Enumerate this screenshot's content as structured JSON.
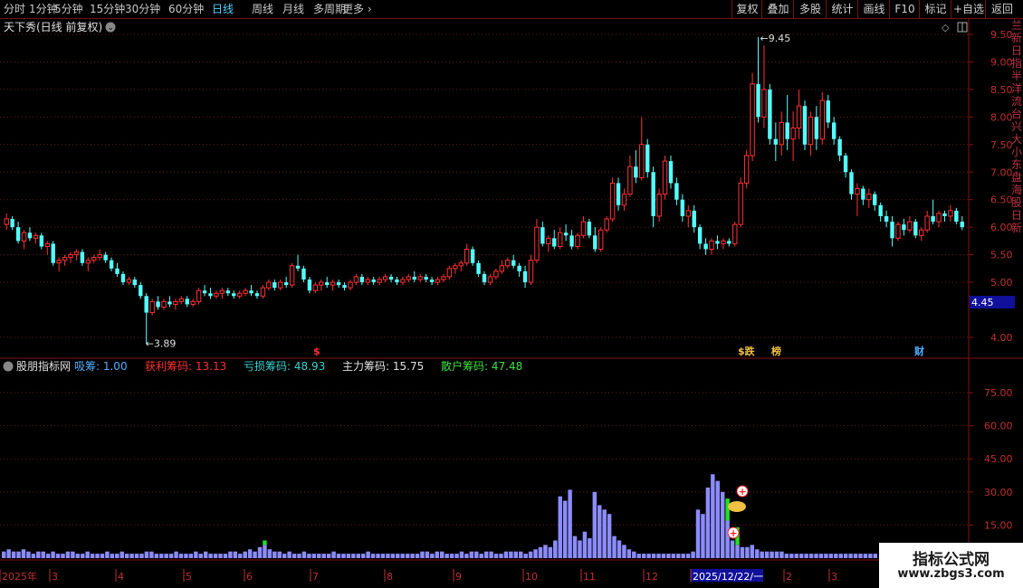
{
  "toolbar": {
    "periods": [
      "分时",
      "1分钟",
      "5分钟",
      "15分钟",
      "30分钟",
      "60分钟",
      "日线",
      "周线",
      "月线",
      "多周期",
      "更多"
    ],
    "active_period": "日线",
    "right_buttons": [
      "复权",
      "叠加",
      "多股",
      "统计",
      "画线",
      "F10",
      "标记",
      "+自选",
      "返回"
    ]
  },
  "main_chart": {
    "title": "天下秀(日线 前复权)",
    "price_axis": [
      "9.50",
      "9.00",
      "8.50",
      "8.00",
      "7.50",
      "7.00",
      "6.50",
      "6.00",
      "5.50",
      "5.00",
      "4.00"
    ],
    "current_price_tag": "4.45",
    "high_label": "9.45",
    "low_label": "3.89",
    "markers": [
      {
        "text": "$",
        "color": "#ff3030"
      },
      {
        "text": "$跌",
        "color": "#f0c040"
      },
      {
        "text": "榜",
        "color": "#f0c040"
      },
      {
        "text": "财",
        "color": "#4fb0ff"
      }
    ],
    "candles": [
      [
        6.05,
        6.25,
        5.95,
        6.15
      ],
      [
        6.15,
        6.2,
        5.95,
        6.0
      ],
      [
        6.0,
        6.1,
        5.7,
        5.75
      ],
      [
        5.75,
        5.95,
        5.6,
        5.9
      ],
      [
        5.9,
        6.0,
        5.75,
        5.8
      ],
      [
        5.8,
        5.9,
        5.7,
        5.85
      ],
      [
        5.85,
        5.9,
        5.6,
        5.65
      ],
      [
        5.65,
        5.75,
        5.5,
        5.7
      ],
      [
        5.7,
        5.75,
        5.3,
        5.35
      ],
      [
        5.35,
        5.45,
        5.2,
        5.4
      ],
      [
        5.4,
        5.5,
        5.3,
        5.45
      ],
      [
        5.45,
        5.55,
        5.35,
        5.5
      ],
      [
        5.5,
        5.6,
        5.4,
        5.55
      ],
      [
        5.55,
        5.6,
        5.3,
        5.35
      ],
      [
        5.35,
        5.45,
        5.2,
        5.4
      ],
      [
        5.4,
        5.5,
        5.35,
        5.45
      ],
      [
        5.45,
        5.6,
        5.4,
        5.5
      ],
      [
        5.5,
        5.55,
        5.35,
        5.4
      ],
      [
        5.4,
        5.45,
        5.2,
        5.25
      ],
      [
        5.25,
        5.35,
        5.1,
        5.15
      ],
      [
        5.15,
        5.2,
        4.95,
        5.0
      ],
      [
        5.0,
        5.1,
        4.95,
        5.05
      ],
      [
        5.05,
        5.1,
        4.9,
        4.95
      ],
      [
        4.95,
        5.0,
        4.7,
        4.75
      ],
      [
        4.75,
        4.8,
        3.89,
        4.45
      ],
      [
        4.45,
        4.7,
        4.4,
        4.65
      ],
      [
        4.65,
        4.75,
        4.5,
        4.55
      ],
      [
        4.55,
        4.7,
        4.5,
        4.65
      ],
      [
        4.65,
        4.75,
        4.55,
        4.6
      ],
      [
        4.6,
        4.7,
        4.5,
        4.65
      ],
      [
        4.65,
        4.75,
        4.6,
        4.7
      ],
      [
        4.7,
        4.75,
        4.55,
        4.6
      ],
      [
        4.6,
        4.7,
        4.55,
        4.65
      ],
      [
        4.65,
        4.9,
        4.6,
        4.85
      ],
      [
        4.85,
        4.95,
        4.75,
        4.8
      ],
      [
        4.8,
        4.9,
        4.7,
        4.75
      ],
      [
        4.75,
        4.85,
        4.7,
        4.8
      ],
      [
        4.8,
        4.9,
        4.7,
        4.85
      ],
      [
        4.85,
        4.9,
        4.75,
        4.8
      ],
      [
        4.8,
        4.85,
        4.7,
        4.75
      ],
      [
        4.75,
        4.85,
        4.7,
        4.8
      ],
      [
        4.8,
        4.9,
        4.75,
        4.85
      ],
      [
        4.85,
        4.95,
        4.75,
        4.8
      ],
      [
        4.8,
        4.85,
        4.7,
        4.75
      ],
      [
        4.75,
        4.95,
        4.7,
        4.9
      ],
      [
        4.9,
        5.05,
        4.85,
        5.0
      ],
      [
        5.0,
        5.05,
        4.85,
        4.9
      ],
      [
        4.9,
        5.05,
        4.85,
        5.0
      ],
      [
        5.0,
        5.1,
        4.9,
        4.95
      ],
      [
        4.95,
        5.35,
        4.9,
        5.3
      ],
      [
        5.3,
        5.5,
        5.2,
        5.25
      ],
      [
        5.25,
        5.3,
        5.0,
        5.05
      ],
      [
        5.05,
        5.1,
        4.8,
        4.85
      ],
      [
        4.85,
        5.0,
        4.8,
        4.95
      ],
      [
        4.95,
        5.05,
        4.85,
        5.0
      ],
      [
        5.0,
        5.1,
        4.9,
        4.95
      ],
      [
        4.95,
        5.05,
        4.85,
        5.0
      ],
      [
        5.0,
        5.05,
        4.9,
        4.95
      ],
      [
        4.95,
        5.0,
        4.85,
        4.9
      ],
      [
        4.9,
        5.05,
        4.85,
        5.0
      ],
      [
        5.0,
        5.15,
        4.95,
        5.1
      ],
      [
        5.1,
        5.15,
        4.95,
        5.0
      ],
      [
        5.0,
        5.1,
        4.95,
        5.05
      ],
      [
        5.05,
        5.1,
        4.95,
        5.0
      ],
      [
        5.0,
        5.1,
        4.95,
        5.05
      ],
      [
        5.05,
        5.15,
        5.0,
        5.1
      ],
      [
        5.1,
        5.15,
        5.0,
        5.05
      ],
      [
        5.05,
        5.1,
        4.95,
        5.0
      ],
      [
        5.0,
        5.1,
        4.95,
        5.05
      ],
      [
        5.05,
        5.15,
        5.0,
        5.1
      ],
      [
        5.1,
        5.2,
        5.0,
        5.05
      ],
      [
        5.05,
        5.15,
        5.0,
        5.1
      ],
      [
        5.1,
        5.15,
        5.0,
        5.05
      ],
      [
        5.05,
        5.1,
        4.95,
        5.0
      ],
      [
        5.0,
        5.1,
        4.95,
        5.05
      ],
      [
        5.05,
        5.15,
        5.0,
        5.1
      ],
      [
        5.1,
        5.3,
        5.05,
        5.25
      ],
      [
        5.25,
        5.35,
        5.15,
        5.3
      ],
      [
        5.3,
        5.4,
        5.2,
        5.35
      ],
      [
        5.35,
        5.7,
        5.3,
        5.6
      ],
      [
        5.6,
        5.65,
        5.3,
        5.35
      ],
      [
        5.35,
        5.4,
        5.1,
        5.15
      ],
      [
        5.15,
        5.2,
        4.95,
        5.0
      ],
      [
        5.0,
        5.15,
        4.95,
        5.1
      ],
      [
        5.1,
        5.25,
        5.05,
        5.2
      ],
      [
        5.2,
        5.4,
        5.15,
        5.3
      ],
      [
        5.3,
        5.45,
        5.25,
        5.4
      ],
      [
        5.4,
        5.5,
        5.25,
        5.3
      ],
      [
        5.3,
        5.35,
        5.1,
        5.2
      ],
      [
        5.2,
        5.3,
        4.9,
        5.0
      ],
      [
        5.0,
        5.5,
        4.95,
        5.4
      ],
      [
        5.4,
        6.15,
        5.35,
        6.0
      ],
      [
        6.0,
        6.1,
        5.65,
        5.7
      ],
      [
        5.7,
        5.85,
        5.55,
        5.8
      ],
      [
        5.8,
        5.95,
        5.6,
        5.65
      ],
      [
        5.65,
        6.0,
        5.6,
        5.9
      ],
      [
        5.9,
        6.05,
        5.75,
        5.85
      ],
      [
        5.85,
        5.95,
        5.6,
        5.65
      ],
      [
        5.65,
        5.9,
        5.6,
        5.85
      ],
      [
        5.85,
        6.2,
        5.8,
        6.1
      ],
      [
        6.1,
        6.15,
        5.8,
        5.85
      ],
      [
        5.85,
        6.0,
        5.55,
        5.6
      ],
      [
        5.6,
        6.0,
        5.55,
        5.95
      ],
      [
        5.95,
        6.2,
        5.9,
        6.15
      ],
      [
        6.15,
        6.9,
        6.1,
        6.8
      ],
      [
        6.8,
        6.9,
        6.3,
        6.4
      ],
      [
        6.4,
        6.7,
        6.3,
        6.6
      ],
      [
        6.6,
        7.3,
        6.55,
        7.1
      ],
      [
        7.1,
        7.4,
        6.8,
        6.9
      ],
      [
        6.9,
        8.0,
        6.85,
        7.5
      ],
      [
        7.5,
        7.6,
        6.9,
        7.0
      ],
      [
        7.0,
        7.1,
        6.0,
        6.2
      ],
      [
        6.2,
        6.7,
        6.1,
        6.6
      ],
      [
        6.6,
        7.3,
        6.5,
        7.2
      ],
      [
        7.2,
        7.3,
        6.7,
        6.8
      ],
      [
        6.8,
        6.9,
        6.4,
        6.5
      ],
      [
        6.5,
        6.6,
        6.1,
        6.2
      ],
      [
        6.2,
        6.4,
        6.0,
        6.3
      ],
      [
        6.3,
        6.4,
        5.9,
        6.0
      ],
      [
        6.0,
        6.05,
        5.6,
        5.7
      ],
      [
        5.7,
        5.8,
        5.5,
        5.6
      ],
      [
        5.6,
        5.8,
        5.5,
        5.75
      ],
      [
        5.75,
        5.85,
        5.6,
        5.7
      ],
      [
        5.7,
        5.8,
        5.6,
        5.75
      ],
      [
        5.75,
        5.8,
        5.65,
        5.7
      ],
      [
        5.7,
        6.1,
        5.65,
        6.05
      ],
      [
        6.05,
        6.9,
        6.0,
        6.8
      ],
      [
        6.8,
        7.4,
        6.7,
        7.3
      ],
      [
        7.3,
        8.8,
        7.2,
        8.6
      ],
      [
        8.6,
        9.45,
        7.9,
        8.0
      ],
      [
        8.0,
        9.3,
        7.8,
        8.5
      ],
      [
        8.5,
        8.6,
        7.5,
        7.6
      ],
      [
        7.6,
        7.9,
        7.2,
        7.5
      ],
      [
        7.5,
        8.1,
        7.3,
        7.9
      ],
      [
        7.9,
        8.4,
        7.4,
        7.6
      ],
      [
        7.6,
        8.1,
        7.2,
        7.8
      ],
      [
        7.8,
        8.5,
        7.6,
        8.2
      ],
      [
        8.2,
        8.3,
        7.4,
        7.5
      ],
      [
        7.5,
        8.1,
        7.3,
        8.0
      ],
      [
        8.0,
        8.2,
        7.4,
        7.6
      ],
      [
        7.6,
        8.45,
        7.5,
        8.3
      ],
      [
        8.3,
        8.4,
        7.8,
        7.9
      ],
      [
        7.9,
        8.0,
        7.5,
        7.6
      ],
      [
        7.6,
        7.65,
        7.2,
        7.3
      ],
      [
        7.3,
        7.35,
        6.9,
        7.0
      ],
      [
        7.0,
        7.05,
        6.5,
        6.6
      ],
      [
        6.6,
        6.8,
        6.2,
        6.7
      ],
      [
        6.7,
        6.75,
        6.4,
        6.5
      ],
      [
        6.5,
        6.7,
        6.35,
        6.6
      ],
      [
        6.6,
        6.65,
        6.3,
        6.4
      ],
      [
        6.4,
        6.45,
        6.1,
        6.2
      ],
      [
        6.2,
        6.3,
        6.0,
        6.1
      ],
      [
        6.1,
        6.2,
        5.65,
        5.8
      ],
      [
        5.8,
        6.1,
        5.75,
        6.05
      ],
      [
        6.05,
        6.15,
        5.85,
        5.95
      ],
      [
        5.95,
        6.2,
        5.9,
        6.1
      ],
      [
        6.1,
        6.15,
        5.8,
        5.85
      ],
      [
        5.85,
        6.0,
        5.75,
        5.95
      ],
      [
        5.95,
        6.3,
        5.9,
        6.2
      ],
      [
        6.2,
        6.5,
        6.05,
        6.1
      ],
      [
        6.1,
        6.3,
        6.0,
        6.25
      ],
      [
        6.25,
        6.3,
        6.1,
        6.2
      ],
      [
        6.2,
        6.4,
        6.1,
        6.3
      ],
      [
        6.3,
        6.35,
        6.05,
        6.1
      ],
      [
        6.1,
        6.2,
        5.95,
        6.0
      ]
    ]
  },
  "indicator": {
    "name": "股朋指标网",
    "legend": [
      {
        "label": "吸筹:",
        "value": "1.00",
        "color": "#4fb0ff"
      },
      {
        "label": "获利筹码:",
        "value": "13.13",
        "color": "#ff3030"
      },
      {
        "label": "亏损筹码:",
        "value": "48.93",
        "color": "#3ad0d0"
      },
      {
        "label": "主力筹码:",
        "value": "15.75",
        "color": "#e0e0e0"
      },
      {
        "label": "散户筹码:",
        "value": "47.48",
        "color": "#40e040"
      }
    ],
    "axis": [
      "75.00",
      "60.00",
      "45.00",
      "30.00",
      "15.00"
    ],
    "bars": [
      3,
      4,
      3,
      3,
      4,
      3,
      2,
      3,
      3,
      2,
      3,
      2,
      2,
      3,
      3,
      2,
      2,
      3,
      2,
      2,
      2,
      3,
      2,
      2,
      3,
      2,
      2,
      2,
      2,
      3,
      3,
      2,
      2,
      2,
      2,
      3,
      2,
      2,
      2,
      3,
      2,
      3,
      2,
      2,
      2,
      2,
      3,
      3,
      2,
      3,
      4,
      3,
      5,
      6,
      4,
      3,
      3,
      2,
      3,
      2,
      2,
      3,
      2,
      2,
      2,
      2,
      2,
      3,
      2,
      2,
      2,
      2,
      2,
      2,
      3,
      2,
      2,
      2,
      2,
      2,
      2,
      2,
      2,
      2,
      2,
      3,
      3,
      2,
      3,
      3,
      2,
      2,
      2,
      3,
      2,
      3,
      3,
      2,
      3,
      3,
      2,
      2,
      3,
      3,
      3,
      3,
      2,
      3,
      4,
      5,
      6,
      5,
      8,
      28,
      26,
      31,
      10,
      8,
      12,
      9,
      30,
      24,
      22,
      20,
      10,
      8,
      6,
      4,
      3,
      2,
      2,
      2,
      2,
      2,
      2,
      2,
      2,
      2,
      2,
      2,
      3,
      22,
      20,
      32,
      38,
      35,
      30,
      17,
      8,
      6,
      5,
      5,
      6,
      4,
      3,
      3,
      3,
      3,
      3,
      2,
      2,
      2,
      2,
      2,
      2,
      2,
      2,
      2,
      2,
      2,
      2,
      2,
      2,
      2,
      2,
      2,
      2,
      2
    ],
    "green_tops": [
      [
        53,
        2
      ],
      [
        147,
        10
      ],
      [
        149,
        8
      ]
    ],
    "time_axis": [
      "2025年",
      "3",
      "4",
      "5",
      "6",
      "7",
      "8",
      "9",
      "10",
      "11",
      "12",
      "2025/12/22/一",
      "2",
      "3"
    ]
  },
  "watermark": {
    "line1": "指标公式网",
    "line2": "www.zbgs3.com"
  },
  "right_strip_chars": [
    "兰",
    "新",
    "日",
    "指",
    "半",
    "洋",
    "流",
    "台",
    "兴",
    "大",
    "小",
    "东",
    "盘",
    "海",
    "股",
    "日",
    "新"
  ]
}
